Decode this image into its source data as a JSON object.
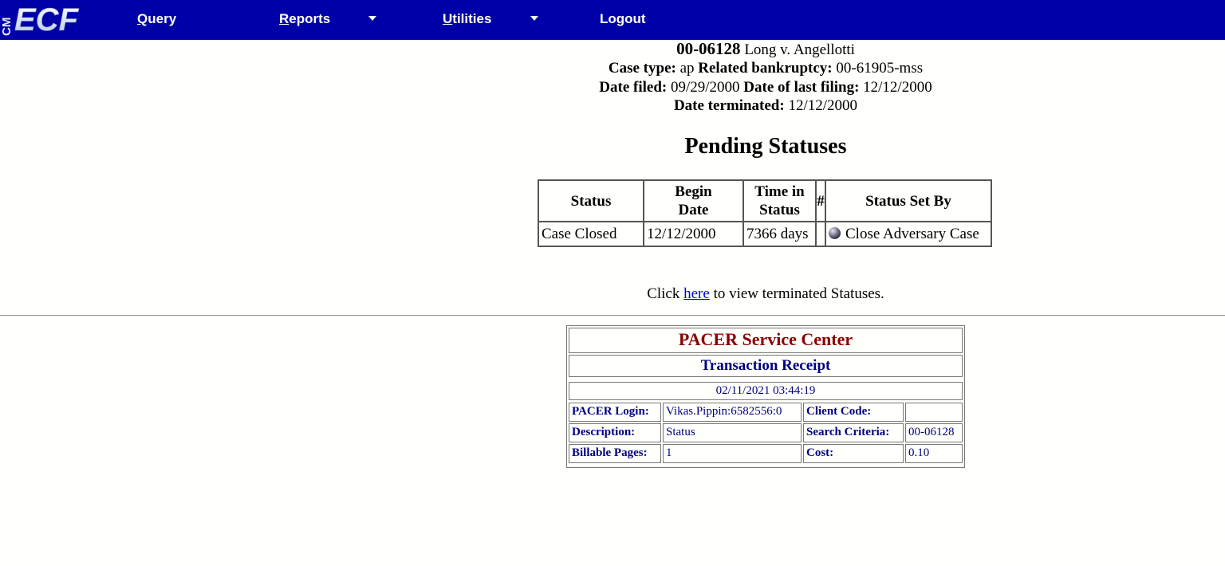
{
  "nav": {
    "logo_text": "ECF",
    "logo_prefix": "CM",
    "items": [
      {
        "label": "Query",
        "accel": "Q",
        "rest": "uery",
        "has_caret": false
      },
      {
        "label": "Reports",
        "accel": "R",
        "rest": "eports",
        "has_caret": true
      },
      {
        "label": "Utilities",
        "accel": "U",
        "rest": "tilities",
        "has_caret": true
      },
      {
        "label": "Logout",
        "accel": "",
        "rest": "Logout",
        "has_caret": false
      }
    ]
  },
  "case": {
    "number": "00-06128",
    "name": "Long v. Angellotti",
    "case_type_label": "Case type:",
    "case_type": "ap",
    "related_label": "Related bankruptcy:",
    "related": "00-61905-mss",
    "date_filed_label": "Date filed:",
    "date_filed": "09/29/2000",
    "last_filing_label": "Date of last filing:",
    "last_filing": "12/12/2000",
    "terminated_label": "Date terminated:",
    "terminated": "12/12/2000"
  },
  "page_title": "Pending Statuses",
  "status_table": {
    "headers": {
      "status": "Status",
      "begin_1": "Begin",
      "begin_2": "Date",
      "time_1": "Time in",
      "time_2": "Status",
      "num": "#",
      "set_by": "Status Set By"
    },
    "rows": [
      {
        "status": "Case Closed",
        "begin": "12/12/2000",
        "time": "7366 days",
        "num": "",
        "set_by": "Close Adversary Case"
      }
    ]
  },
  "click_line": {
    "before": "Click",
    "link": "here",
    "after": "to view terminated Statuses."
  },
  "receipt": {
    "title": "PACER Service Center",
    "subtitle": "Transaction Receipt",
    "timestamp": "02/11/2021 03:44:19",
    "login_label": "PACER Login:",
    "login": "Vikas.Pippin:6582556:0",
    "client_label": "Client Code:",
    "client": "",
    "desc_label": "Description:",
    "desc": "Status",
    "criteria_label": "Search Criteria:",
    "criteria": "00-06128",
    "pages_label": "Billable Pages:",
    "pages": "1",
    "cost_label": "Cost:",
    "cost": "0.10"
  },
  "colors": {
    "nav_bg": "#0000a8",
    "receipt_title": "#8b0000",
    "receipt_text": "#000080",
    "link": "#0000ee"
  }
}
